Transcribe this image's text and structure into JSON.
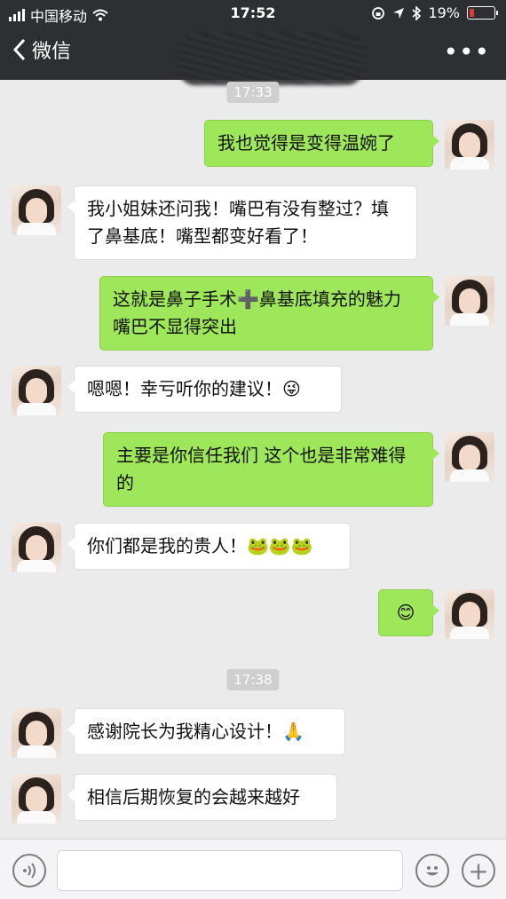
{
  "status_bar": {
    "carrier": "中国移动",
    "time": "17:52",
    "battery": "19%",
    "battery_level": 0.19,
    "icons": [
      "signal-icon",
      "wifi-icon",
      "orientation-lock-icon",
      "location-icon",
      "bluetooth-icon",
      "battery-icon"
    ]
  },
  "nav": {
    "back_label": "微信",
    "more_label": "•••"
  },
  "chat": {
    "timestamps": [
      "17:33",
      "17:38"
    ],
    "messages": [
      {
        "side": "right",
        "text": "我也觉得是变得温婉了"
      },
      {
        "side": "left",
        "text": "我小姐妹还问我！嘴巴有没有整过？填了鼻基底！嘴型都变好看了！"
      },
      {
        "side": "right",
        "text": "这就是鼻子手术➕鼻基底填充的魅力 嘴巴不显得突出"
      },
      {
        "side": "left",
        "text": "嗯嗯！幸亏听你的建议！😜"
      },
      {
        "side": "right",
        "text": "主要是你信任我们 这个也是非常难得的"
      },
      {
        "side": "left",
        "text": "你们都是我的贵人！🐸🐸🐸"
      },
      {
        "side": "right",
        "text": "😊"
      },
      {
        "side": "left",
        "text": "感谢院长为我精心设计！🙏"
      },
      {
        "side": "left",
        "text": "相信后期恢复的会越来越好"
      }
    ]
  },
  "input_bar": {
    "voice_icon": "voice-icon",
    "emoji_icon": "emoji-icon",
    "plus_icon": "plus-icon",
    "plus_label": "+",
    "emoji_glyph": "☺",
    "voice_glyph": "◖))"
  }
}
